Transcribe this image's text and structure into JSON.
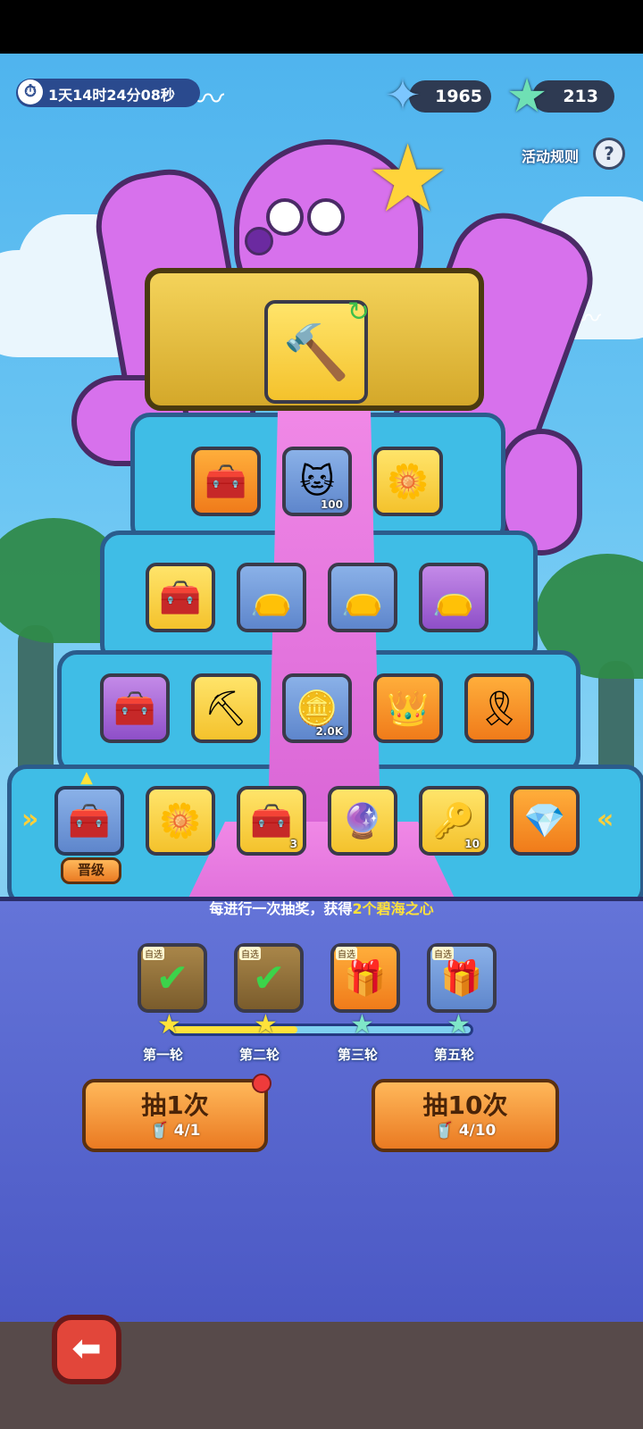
{
  "timer": {
    "text": "1天14时24分08秒"
  },
  "currency": {
    "blue_star": {
      "value": "1965",
      "icon": "blue-star-plus-icon"
    },
    "green_star": {
      "value": "213",
      "icon": "green-star-icon"
    }
  },
  "rules": {
    "label": "活动规则",
    "icon": "question-icon"
  },
  "grand_prize": {
    "icon": "golden-hammer-icon"
  },
  "rows": [
    [
      {
        "icon": "chest-icon",
        "glyph": "🧰",
        "color": "orange",
        "qty": ""
      },
      {
        "icon": "cat-cookie-icon",
        "glyph": "🐱",
        "color": "blue",
        "qty": "100"
      },
      {
        "icon": "dandelion-icon",
        "glyph": "🌼",
        "color": "yellow",
        "qty": ""
      }
    ],
    [
      {
        "icon": "chest-icon",
        "glyph": "🧰",
        "color": "yellow",
        "qty": ""
      },
      {
        "icon": "mystery-bag-icon",
        "glyph": "👝",
        "color": "blue",
        "qty": ""
      },
      {
        "icon": "mystery-bag-icon",
        "glyph": "👝",
        "color": "blue",
        "qty": ""
      },
      {
        "icon": "mystery-bag-icon",
        "glyph": "👝",
        "color": "purple",
        "qty": ""
      }
    ],
    [
      {
        "icon": "chest-icon",
        "glyph": "🧰",
        "color": "purple",
        "qty": ""
      },
      {
        "icon": "pickaxe-icon",
        "glyph": "⛏",
        "color": "yellow",
        "qty": ""
      },
      {
        "icon": "coin-icon",
        "glyph": "🪙",
        "color": "blue",
        "qty": "2.0K"
      },
      {
        "icon": "crown-bag-icon",
        "glyph": "👑",
        "color": "orange",
        "qty": ""
      },
      {
        "icon": "gold-ribbon-icon",
        "glyph": "🎗",
        "color": "orange",
        "qty": ""
      }
    ],
    [
      {
        "icon": "chest-icon",
        "glyph": "🧰",
        "color": "blue",
        "qty": ""
      },
      {
        "icon": "dandelion-icon",
        "glyph": "🌼",
        "color": "yellow",
        "qty": ""
      },
      {
        "icon": "chest-icon",
        "glyph": "🧰",
        "color": "yellow",
        "qty": "3"
      },
      {
        "icon": "purple-orb-icon",
        "glyph": "🔮",
        "color": "yellow",
        "qty": ""
      },
      {
        "icon": "key-icon",
        "glyph": "🔑",
        "color": "yellow",
        "qty": "10"
      },
      {
        "icon": "crystal-icon",
        "glyph": "💎",
        "color": "orange",
        "qty": ""
      }
    ]
  ],
  "upgrade": {
    "label": "晋级"
  },
  "info": {
    "prefix": "每进行一次抽奖，获得",
    "highlight": "2个碧海之心"
  },
  "milestones": [
    {
      "pick_label": "自选",
      "color": "brown",
      "claimed": true,
      "glyph": "🧰",
      "round": "第一轮"
    },
    {
      "pick_label": "自选",
      "color": "brown",
      "claimed": true,
      "glyph": "🧰",
      "round": "第二轮"
    },
    {
      "pick_label": "自选",
      "color": "orange",
      "claimed": false,
      "glyph": "🎁",
      "round": "第三轮"
    },
    {
      "pick_label": "自选",
      "color": "blue",
      "claimed": false,
      "glyph": "🎁",
      "round": "第五轮"
    }
  ],
  "progress": {
    "fraction": 0.42
  },
  "draw_once": {
    "label": "抽1次",
    "cost": "4/1"
  },
  "draw_ten": {
    "label": "抽10次",
    "cost": "4/10"
  },
  "back": {
    "icon": "back-arrow-icon"
  }
}
